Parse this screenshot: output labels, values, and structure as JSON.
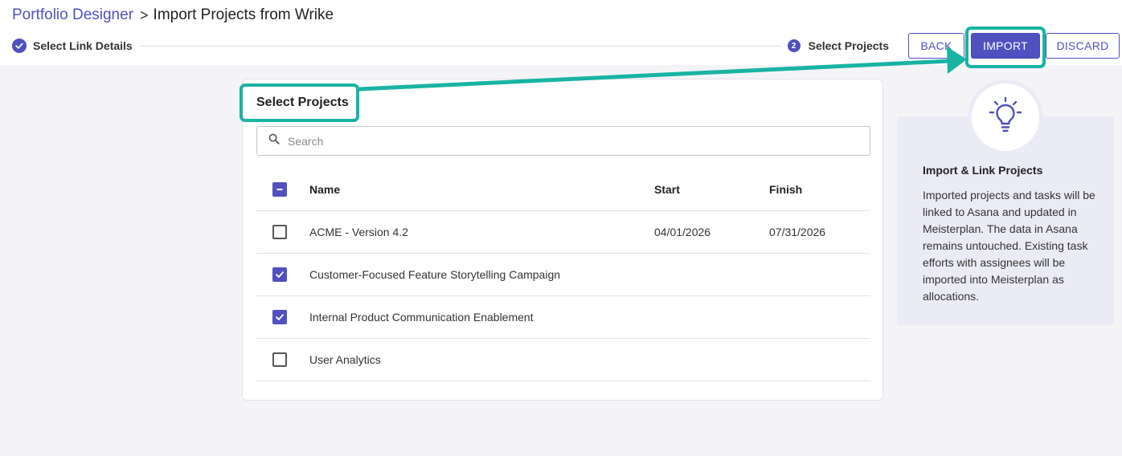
{
  "breadcrumb": {
    "parent": "Portfolio Designer",
    "separator": ">",
    "current": "Import Projects from Wrike"
  },
  "stepper": {
    "step1_label": "Select Link Details",
    "step2_number": "2",
    "step2_label": "Select Projects"
  },
  "actions": {
    "back": "BACK",
    "import": "IMPORT",
    "discard": "DISCARD"
  },
  "panel": {
    "title": "Select Projects",
    "search_placeholder": "Search",
    "columns": {
      "name": "Name",
      "start": "Start",
      "finish": "Finish"
    },
    "rows": [
      {
        "name": "ACME - Version 4.2",
        "start": "04/01/2026",
        "finish": "07/31/2026",
        "checked": false
      },
      {
        "name": "Customer-Focused Feature Storytelling Campaign",
        "start": "",
        "finish": "",
        "checked": true
      },
      {
        "name": "Internal Product Communication Enablement",
        "start": "",
        "finish": "",
        "checked": true
      },
      {
        "name": "User Analytics",
        "start": "",
        "finish": "",
        "checked": false
      }
    ]
  },
  "info": {
    "icon": "lightbulb-icon",
    "title": "Import & Link Projects",
    "text": "Imported projects and tasks will be linked to Asana and updated in Meisterplan. The data in Asana remains untouched. Existing task efforts with assignees will be imported into Meisterplan as allocations."
  },
  "colors": {
    "accent": "#5050c0",
    "highlight": "#19b3a4"
  }
}
